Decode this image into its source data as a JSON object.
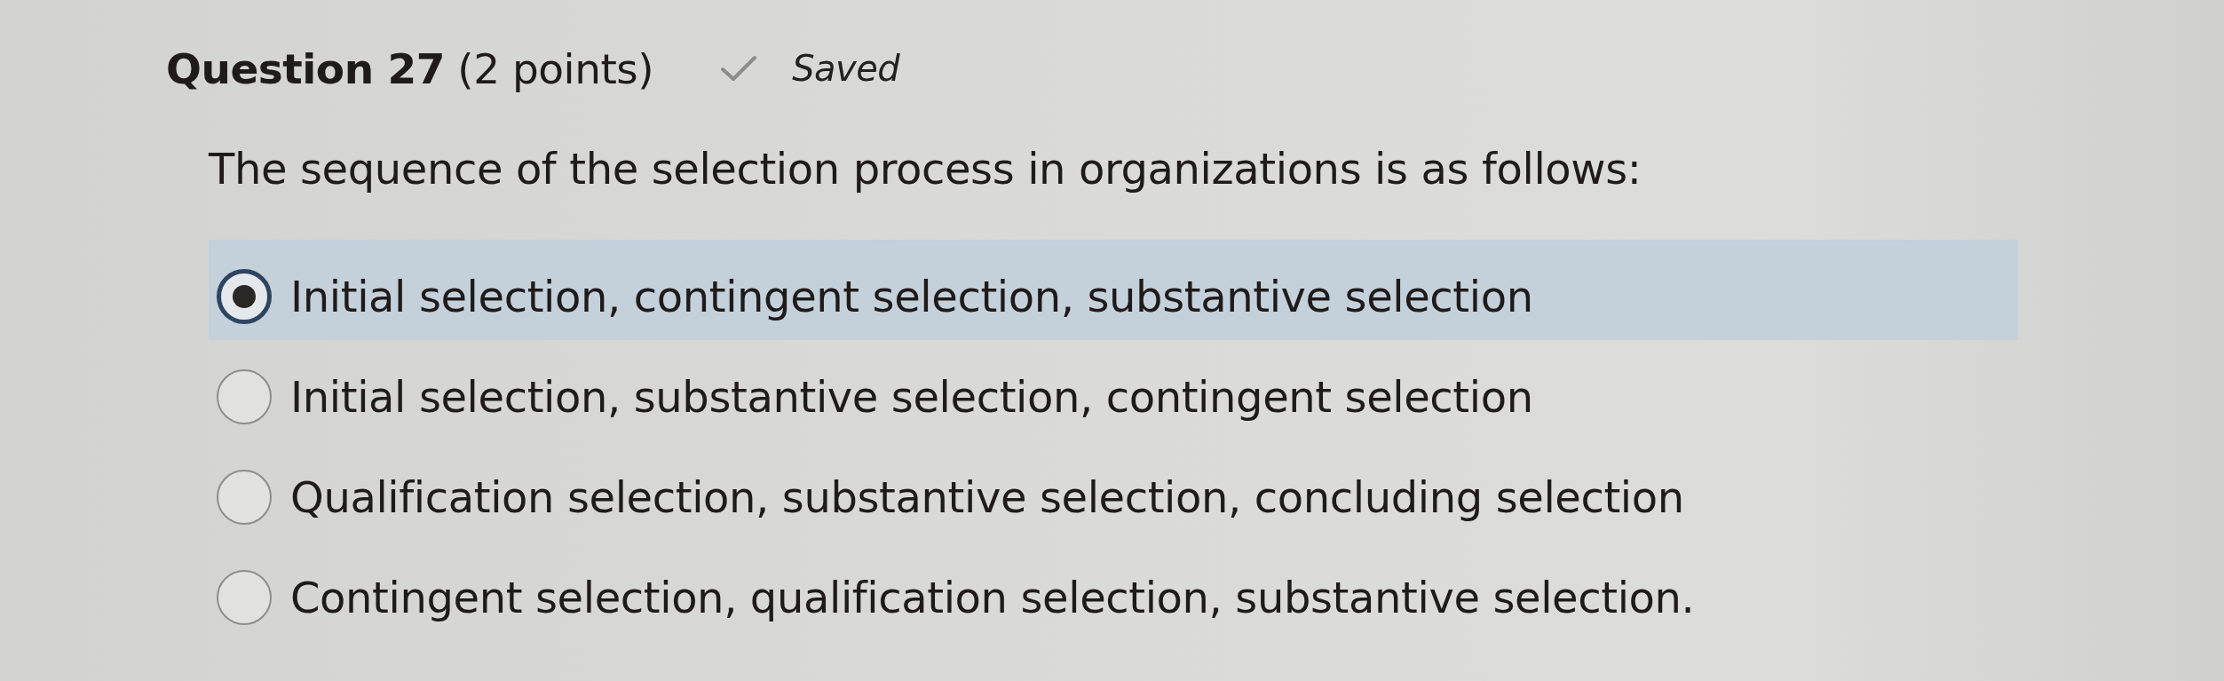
{
  "question": {
    "title": "**Question 27** (2 points)",
    "status": "Saved",
    "prompt": "The sequence of the selection process in organizations is as follows:"
  },
  "options": [
    {
      "label": "Initial selection, contingent selection, substantive selection",
      "selected": true
    },
    {
      "label": "Initial selection, substantive selection, contingent selection",
      "selected": false
    },
    {
      "label": "Qualification selection, substantive selection, concluding selection",
      "selected": false
    },
    {
      "label": "Contingent selection, qualification selection, substantive selection.",
      "selected": false
    }
  ]
}
